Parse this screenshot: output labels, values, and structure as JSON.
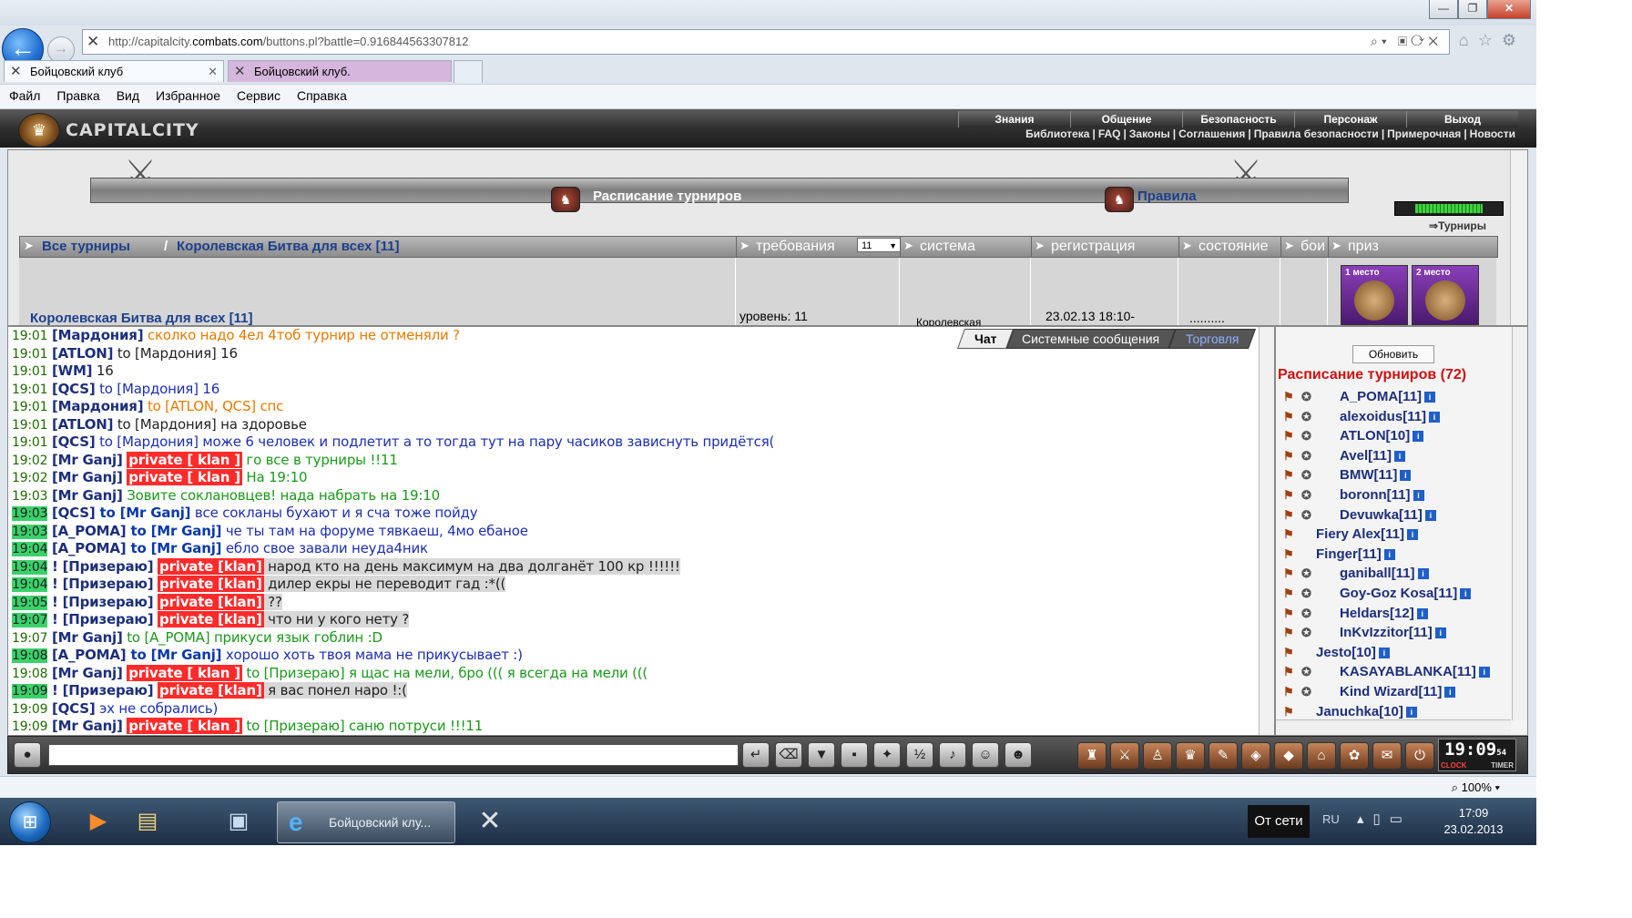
{
  "browser": {
    "url_prefix": "http://capitalcity.",
    "url_domain": "combats.com",
    "url_rest": "/buttons.pl?battle=0.916844563307812",
    "tabs": [
      {
        "label": "Бойцовский клуб"
      },
      {
        "label": "Бойцовский клуб."
      }
    ],
    "menu": [
      "Файл",
      "Правка",
      "Вид",
      "Избранное",
      "Сервис",
      "Справка"
    ],
    "zoom": "100%"
  },
  "game": {
    "logo_text": "CAPITALCITY",
    "top_menu": [
      "Знания",
      "Общение",
      "Безопасность",
      "Персонаж",
      "Выход"
    ],
    "sub_menu": [
      "Библиотека",
      "FAQ",
      "Законы",
      "Соглашения",
      "Правила безопасности",
      "Примерочная",
      "Новости"
    ],
    "banner_title": "Расписание турниров",
    "banner_rules": "Правила",
    "tour_link": "Турниры",
    "breadcrumb_all": "Все турниры",
    "breadcrumb_sep": "/",
    "breadcrumb_current": "Королевская Битва для всех [11]",
    "columns": [
      "требования",
      "система",
      "регистрация",
      "состояние",
      "бои",
      "приз"
    ],
    "level_select": "11",
    "row": {
      "name": "Королевская Битва для всех [11]",
      "level": "уровень: 11",
      "system": "Королевская",
      "registration": "23.02.13 18:10-",
      "status": "..........",
      "prize1": "1 место",
      "prize2": "2 место"
    },
    "hp_fraction": 0.8,
    "chat_tabs": [
      "Чат",
      "Системные сообщения",
      "Торговля"
    ],
    "chat": [
      {
        "t": "19:01",
        "hl": false,
        "nick": "[Мардония]",
        "mid": "",
        "text": " сколко надо 4ел 4тоб турнир не отменяли ?",
        "cls": "c-orange"
      },
      {
        "t": "19:01",
        "hl": false,
        "nick": "[ATLON]",
        "mid": " to [Мардония]",
        "text": " 16",
        "cls": "c-dark"
      },
      {
        "t": "19:01",
        "hl": false,
        "nick": "[WM]",
        "mid": "",
        "text": " 16",
        "cls": "c-dark"
      },
      {
        "t": "19:01",
        "hl": false,
        "nick": "[QCS]",
        "mid": " to [Мардония]",
        "text": " 16",
        "cls": "c-blue"
      },
      {
        "t": "19:01",
        "hl": false,
        "nick": "[Мардония]",
        "mid": " to [ATLON, QCS]",
        "text": " спс",
        "cls": "c-orange"
      },
      {
        "t": "19:01",
        "hl": false,
        "nick": "[ATLON]",
        "mid": " to [Мардония]",
        "text": " на здоровье",
        "cls": "c-dark"
      },
      {
        "t": "19:01",
        "hl": false,
        "nick": "[QCS]",
        "mid": " to [Мардония]",
        "text": " може 6 человек и подлетит а то тогда тут на пару часиков зависнуть придётся(",
        "cls": "c-blue"
      },
      {
        "t": "19:02",
        "hl": false,
        "nick": "[Mr Ganj]",
        "priv": "private [ klan ]",
        "text": " го все в турниры !!11",
        "cls": "c-green"
      },
      {
        "t": "19:02",
        "hl": false,
        "nick": "[Mr Ganj]",
        "priv": "private [ klan ]",
        "text": " На 19:10",
        "cls": "c-green"
      },
      {
        "t": "19:03",
        "hl": false,
        "nick": "[Mr Ganj]",
        "mid": "",
        "text": " Зовите соклановцев! нада набрать на 19:10",
        "cls": "c-green"
      },
      {
        "t": "19:03",
        "hl": true,
        "nick": "[QCS]",
        "mid": " to [Mr Ganj]",
        "text": " все сокланы бухают и я сча тоже пойду",
        "cls": "c-blue",
        "bold_mid": true
      },
      {
        "t": "19:03",
        "hl": true,
        "nick": "[A_POMA]",
        "mid": " to [Mr Ganj]",
        "text": " че ты там на форуме тявкаеш, 4мо ебаное",
        "cls": "c-blue",
        "bold_mid": true
      },
      {
        "t": "19:04",
        "hl": true,
        "nick": "[A_POMA]",
        "mid": " to [Mr Ganj]",
        "text": " ебло свое завали неуда4ник",
        "cls": "c-blue",
        "bold_mid": true
      },
      {
        "t": "19:04",
        "hl": true,
        "nick": "! [Призераю]",
        "privr": "private [klan]",
        "text": " народ кто на день максимум на два долганёт 100 кр !!!!!!",
        "cls": "c-dark",
        "gray": true
      },
      {
        "t": "19:04",
        "hl": true,
        "nick": "! [Призераю]",
        "privr": "private [klan]",
        "text": " дилер екры не переводит гад :*((",
        "cls": "c-dark",
        "gray": true
      },
      {
        "t": "19:05",
        "hl": true,
        "nick": "! [Призераю]",
        "privr": "private [klan]",
        "text": " ??",
        "cls": "c-dark",
        "gray": true
      },
      {
        "t": "19:07",
        "hl": true,
        "nick": "! [Призераю]",
        "privr": "private [klan]",
        "text": " что ни у кого нету ?",
        "cls": "c-dark",
        "gray": true
      },
      {
        "t": "19:07",
        "hl": false,
        "nick": "[Mr Ganj]",
        "mid": " to [A_POMA]",
        "text": " прикуси язык гоблин :D",
        "cls": "c-green"
      },
      {
        "t": "19:08",
        "hl": true,
        "nick": "[A_POMA]",
        "mid": " to [Mr Ganj]",
        "text": " хорошо хоть твоя мама не прикусывает :)",
        "cls": "c-blue",
        "bold_mid": true
      },
      {
        "t": "19:08",
        "hl": false,
        "nick": "[Mr Ganj]",
        "priv": "private [ klan ]",
        "text": " to [Призераю] я щас на мели, бро ((( я всегда на мели (((",
        "cls": "c-green"
      },
      {
        "t": "19:09",
        "hl": true,
        "nick": "! [Призераю]",
        "privr": "private [klan]",
        "text": " я вас понел наро !:(",
        "cls": "c-dark",
        "gray": true
      },
      {
        "t": "19:09",
        "hl": false,
        "nick": "[QCS]",
        "mid": "",
        "text": " эх не собрались)",
        "cls": "c-blue"
      },
      {
        "t": "19:09",
        "hl": false,
        "nick": "[Mr Ganj]",
        "priv": "private [ klan ]",
        "text": " to [Призераю] саню потруси !!!11",
        "cls": "c-green"
      }
    ],
    "right_panel": {
      "refresh": "Обновить",
      "title": "Расписание турниров (72)",
      "players": [
        {
          "name": "A_POMA",
          "lvl": "[11]",
          "x": 62
        },
        {
          "name": "alexoidus",
          "lvl": "[11]",
          "x": 62
        },
        {
          "name": "ATLON",
          "lvl": "[10]",
          "x": 62
        },
        {
          "name": "Avel",
          "lvl": "[11]",
          "x": 62
        },
        {
          "name": "BMW",
          "lvl": "[11]",
          "x": 62
        },
        {
          "name": "boronn",
          "lvl": "[11]",
          "x": 62
        },
        {
          "name": "Devuwka",
          "lvl": "[11]",
          "x": 62
        },
        {
          "name": "Fiery Alex",
          "lvl": "[11]",
          "x": 36
        },
        {
          "name": "Finger",
          "lvl": "[11]",
          "x": 36
        },
        {
          "name": "ganiball",
          "lvl": "[11]",
          "x": 62
        },
        {
          "name": "Goy-Goz Kosa",
          "lvl": "[11]",
          "x": 62
        },
        {
          "name": "Heldars",
          "lvl": "[12]",
          "x": 62
        },
        {
          "name": "InKvIzzitor",
          "lvl": "[11]",
          "x": 62
        },
        {
          "name": "Jesto",
          "lvl": "[10]",
          "x": 36
        },
        {
          "name": "KASAYABLANKA",
          "lvl": "[11]",
          "x": 62
        },
        {
          "name": "Kind Wizard",
          "lvl": "[11]",
          "x": 62
        },
        {
          "name": "Januchka",
          "lvl": "[10]",
          "x": 36
        }
      ]
    },
    "clock": {
      "time": "19:09",
      "sec": "54",
      "label1": "CLOCK",
      "label2": "TIMER"
    }
  },
  "taskbar": {
    "ie_label": "Бойцовский клу...",
    "offline": "От сети",
    "lang": "RU",
    "time": "17:09",
    "date": "23.02.2013"
  }
}
